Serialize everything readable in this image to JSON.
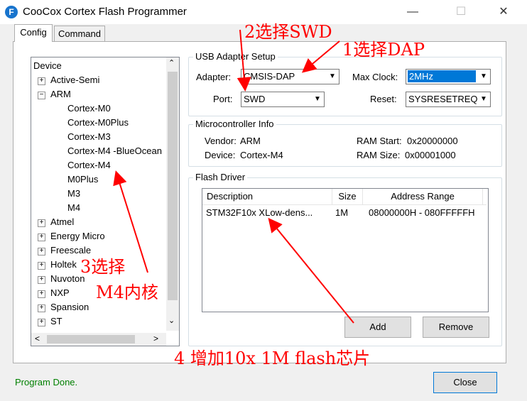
{
  "window": {
    "title": "CooCox Cortex Flash Programmer",
    "icon_letter": "F",
    "controls": {
      "minimize": "—",
      "maximize": "☐",
      "close": "✕"
    }
  },
  "tabs": [
    {
      "label": "Config",
      "active": true
    },
    {
      "label": "Command",
      "active": false
    }
  ],
  "tree": {
    "header": "Device",
    "items": [
      {
        "label": "Active-Semi",
        "expander": "+"
      },
      {
        "label": "ARM",
        "expander": "−"
      },
      {
        "label": "Cortex-M0"
      },
      {
        "label": "Cortex-M0Plus"
      },
      {
        "label": "Cortex-M3"
      },
      {
        "label": "Cortex-M4 -BlueOcean"
      },
      {
        "label": "Cortex-M4"
      },
      {
        "label": "M0Plus"
      },
      {
        "label": "M3"
      },
      {
        "label": "M4"
      },
      {
        "label": "Atmel",
        "expander": "+"
      },
      {
        "label": "Energy Micro",
        "expander": "+"
      },
      {
        "label": "Freescale",
        "expander": "+"
      },
      {
        "label": "Holtek",
        "expander": "+"
      },
      {
        "label": "Nuvoton",
        "expander": "+"
      },
      {
        "label": "NXP",
        "expander": "+"
      },
      {
        "label": "Spansion",
        "expander": "+"
      },
      {
        "label": "ST",
        "expander": "+"
      }
    ],
    "scroll_up": "⌃",
    "scroll_down": "⌄",
    "scroll_left": "<",
    "scroll_right": ">"
  },
  "usb_setup": {
    "title": "USB Adapter Setup",
    "adapter_label": "Adapter:",
    "adapter_value": "CMSIS-DAP",
    "port_label": "Port:",
    "port_value": "SWD",
    "maxclock_label": "Max Clock:",
    "maxclock_value": "2MHz",
    "reset_label": "Reset:",
    "reset_value": "SYSRESETREQ"
  },
  "mcu_info": {
    "title": "Microcontroller Info",
    "vendor_label": "Vendor:",
    "vendor_value": "ARM",
    "device_label": "Device:",
    "device_value": "Cortex-M4",
    "ramstart_label": "RAM Start:",
    "ramstart_value": "0x20000000",
    "ramsize_label": "RAM Size:",
    "ramsize_value": "0x00001000"
  },
  "flash_driver": {
    "title": "Flash Driver",
    "columns": [
      "Description",
      "Size",
      "Address Range"
    ],
    "rows": [
      {
        "description": "STM32F10x XLow-dens...",
        "size": "1M",
        "range": "08000000H - 080FFFFFH"
      }
    ],
    "add_label": "Add",
    "remove_label": "Remove"
  },
  "status": "Program Done.",
  "close_label": "Close",
  "annotations": {
    "a1": "1选择DAP",
    "a2": "2选择SWD",
    "a3_line1": "3选择",
    "a3_line2": "M4内核",
    "a4": "4 增加10x 1M flash芯片"
  },
  "colors": {
    "annotation": "#ff0000",
    "status": "#008000",
    "selection": "#0078d7"
  }
}
